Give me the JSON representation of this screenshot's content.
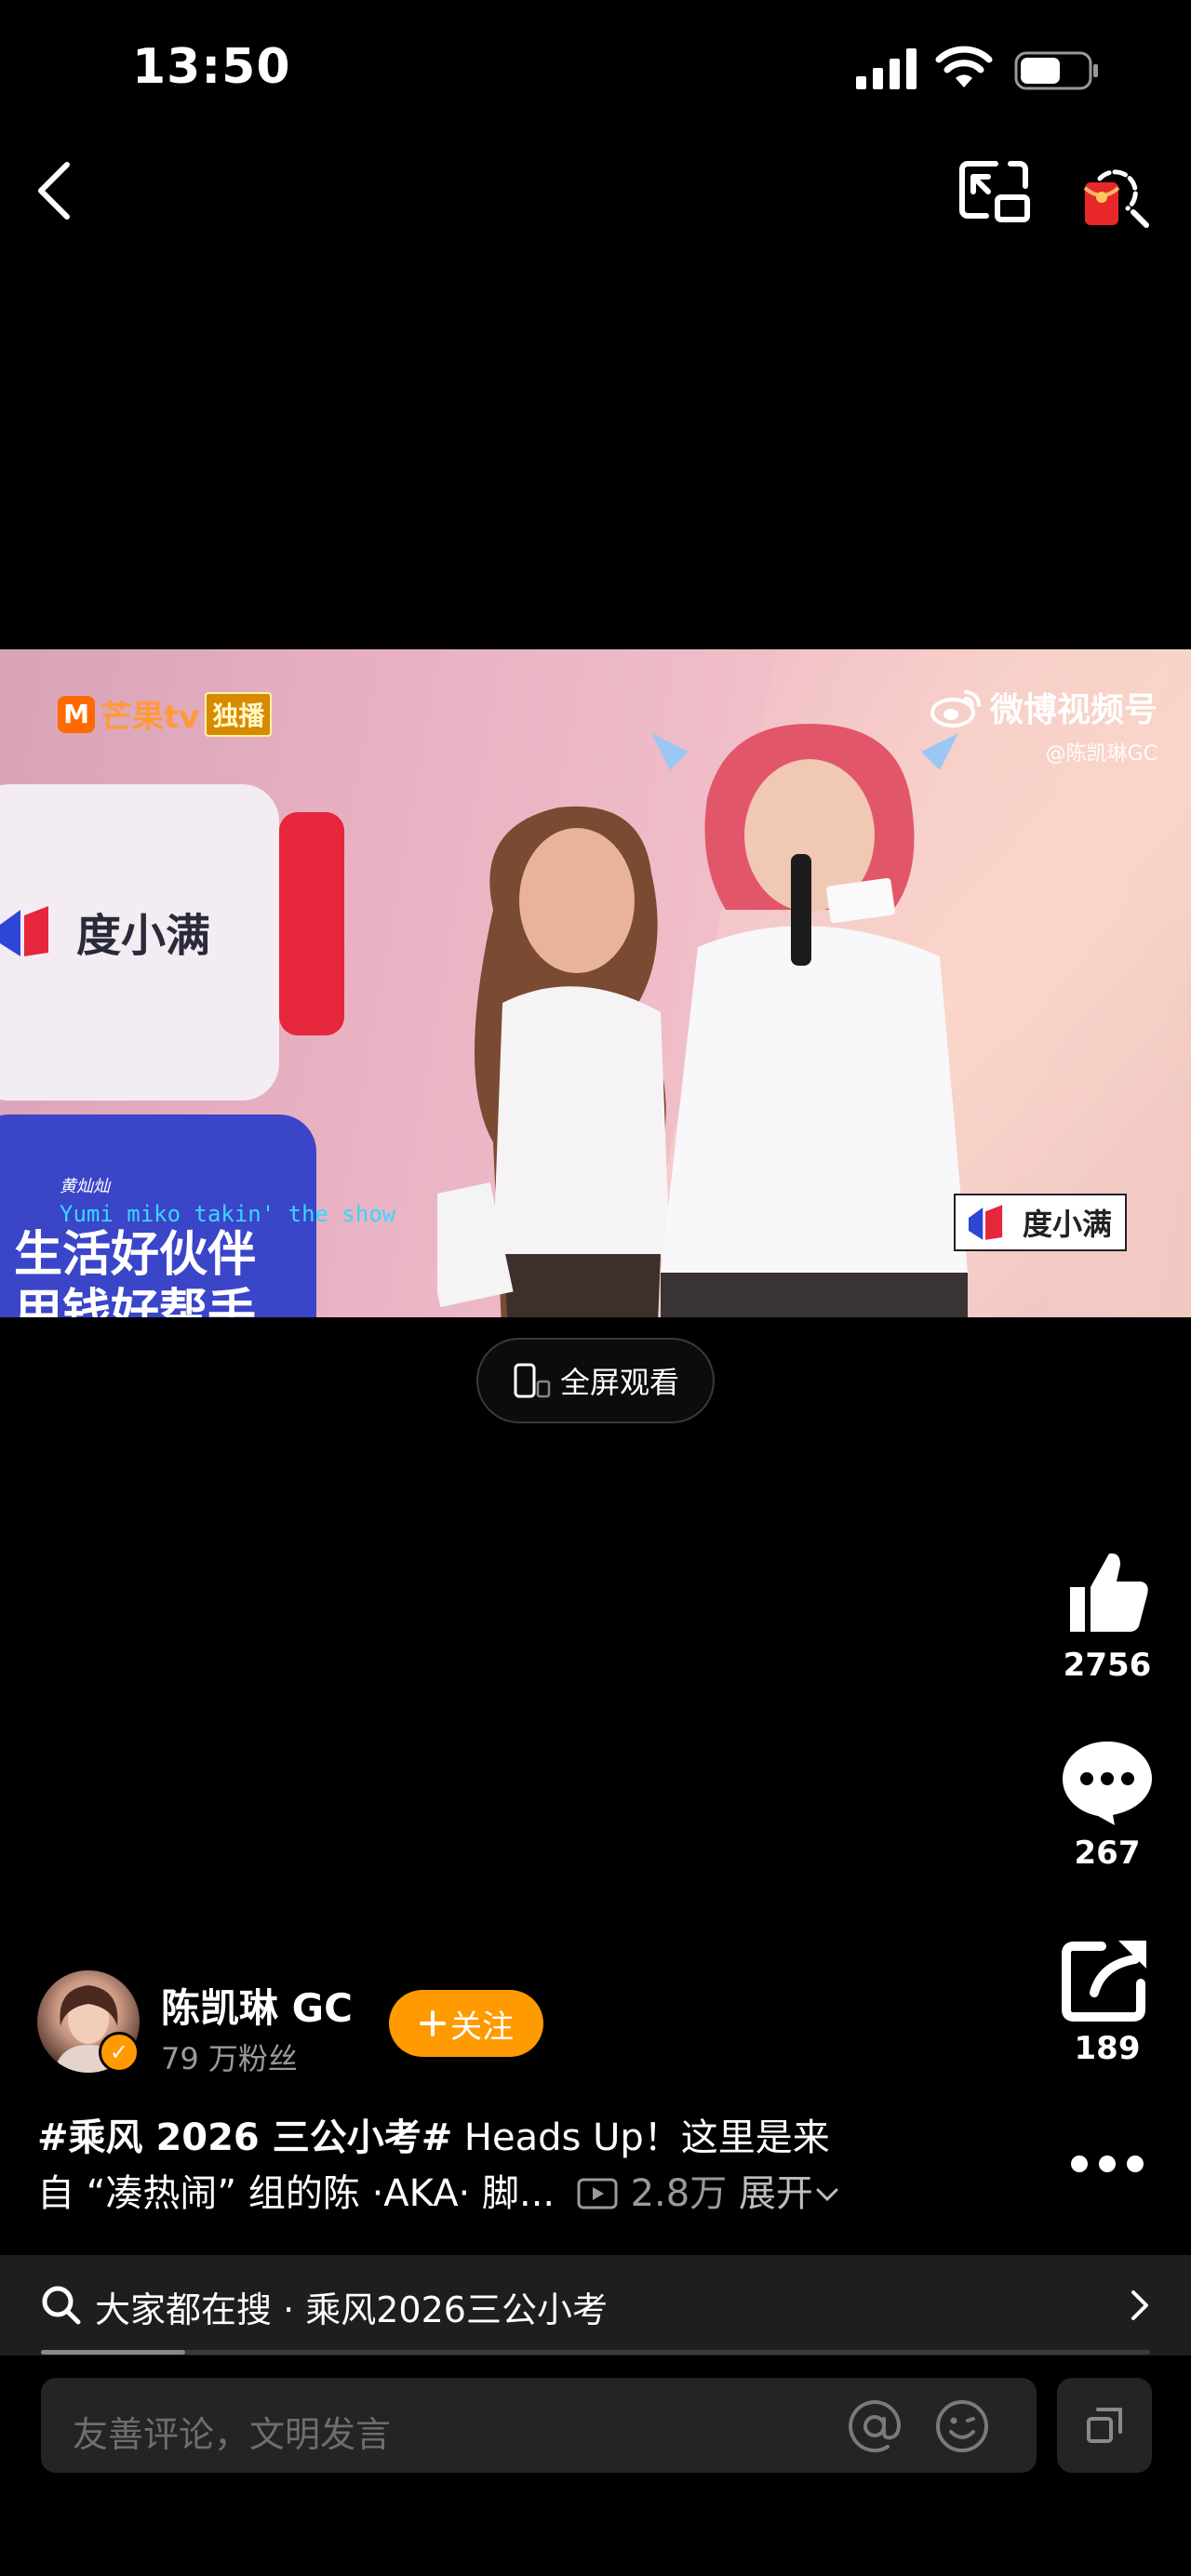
{
  "status_bar": {
    "time": "13:50",
    "icons": [
      "signal-icon",
      "wifi-icon",
      "battery-icon"
    ]
  },
  "top_nav": {
    "back_icon": "chevron-left-icon",
    "pip_icon": "picture-in-picture-icon",
    "redpack_icon": "red-envelope-search-icon"
  },
  "video": {
    "logo_mango": "芒果tv",
    "logo_exclusive": "独播",
    "weibo_title": "微博视频号",
    "weibo_handle": "@陈凯琳GC",
    "brand_left": "度小满",
    "brand_right": "度小满",
    "bottom_text": "生活好伙伴 用钱好帮手",
    "subtitle_name": "黄灿灿",
    "subtitle_line": "Yumi miko takin' the show",
    "brand_colors": {
      "red": "#e6263b",
      "blue": "#2d46d6"
    }
  },
  "fullscreen": {
    "label": "全屏观看"
  },
  "rail": {
    "likes": "2756",
    "comments": "267",
    "shares": "189"
  },
  "author": {
    "name": "陈凯琳 GC",
    "fans": "79 万粉丝",
    "follow_label": "关注",
    "accent": "#ff9a00"
  },
  "caption": {
    "tag": "#乘风 2026 三公小考#",
    "line1_rest": " Heads Up！这里是来",
    "line2": "自 “凑热闹” 组的陈 ·AKA· 脚...",
    "plays": "2.8万",
    "expand": "展开"
  },
  "search_strip": {
    "text": "大家都在搜 · 乘风2026三公小考",
    "progress": 0.13
  },
  "comment_bar": {
    "placeholder": "友善评论，文明发言"
  }
}
